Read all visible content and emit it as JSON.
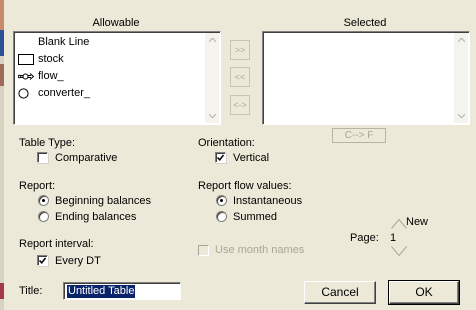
{
  "lists": {
    "allowable_header": "Allowable",
    "selected_header": "Selected",
    "allowable_items": [
      {
        "label": "Blank Line",
        "icon": "none"
      },
      {
        "label": "stock",
        "icon": "stock-icon"
      },
      {
        "label": "flow_",
        "icon": "flow-icon"
      },
      {
        "label": "converter_",
        "icon": "converter-icon"
      }
    ]
  },
  "transfer_buttons": {
    "add": ">>",
    "remove": "<<",
    "swap": "<->",
    "convert": "C--> F"
  },
  "table_type": {
    "label": "Table Type:",
    "comparative_label": "Comparative",
    "comparative_checked": false
  },
  "orientation": {
    "label": "Orientation:",
    "vertical_label": "Vertical",
    "vertical_checked": true
  },
  "report": {
    "label": "Report:",
    "options": [
      "Beginning balances",
      "Ending balances"
    ],
    "selected": "Beginning balances"
  },
  "report_flow": {
    "label": "Report flow values:",
    "options": [
      "Instantaneous",
      "Summed"
    ],
    "selected": "Instantaneous"
  },
  "report_interval": {
    "label": "Report interval:",
    "every_dt_label": "Every DT",
    "every_dt_checked": true
  },
  "month_names": {
    "label": "Use month names",
    "checked": false,
    "enabled": false
  },
  "page": {
    "new_label": "New",
    "label": "Page:",
    "value": "1"
  },
  "title_field": {
    "label": "Title:",
    "value": "Untitled Table"
  },
  "buttons": {
    "cancel": "Cancel",
    "ok": "OK"
  },
  "colors": {
    "dialog_bg": "#ece9d8",
    "selection_bg": "#0a246a",
    "disabled_text": "#a8a699"
  }
}
